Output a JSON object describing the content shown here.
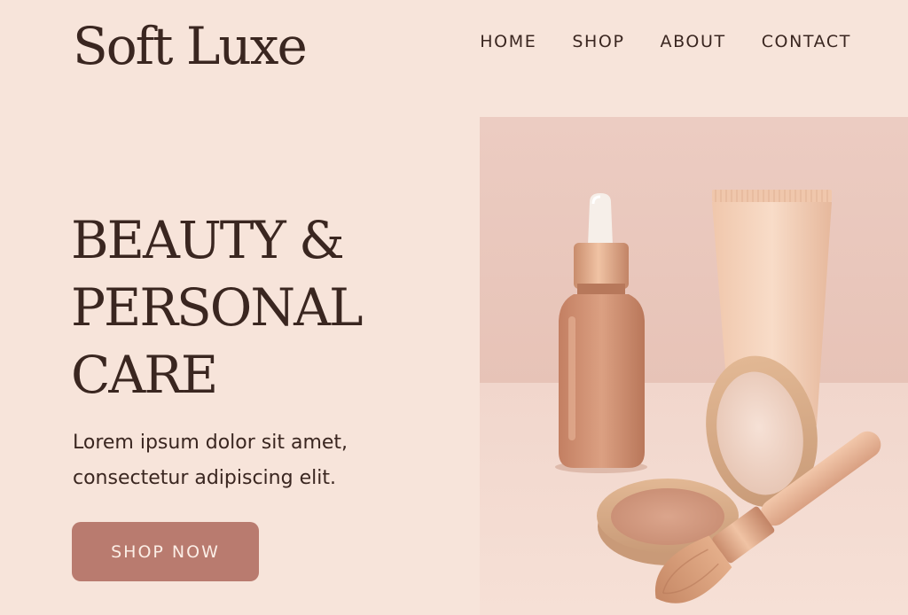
{
  "brand": {
    "name": "Soft Luxe"
  },
  "nav": {
    "items": [
      {
        "label": "HOME"
      },
      {
        "label": "SHOP"
      },
      {
        "label": "ABOUT"
      },
      {
        "label": "CONTACT"
      }
    ]
  },
  "hero": {
    "headline_lines": [
      "BEAUTY &",
      "PERSONAL",
      "CARE"
    ],
    "subtext_lines": [
      "Lorem ipsum dolor sit amet,",
      "consectetur adipiscing elit."
    ],
    "cta_label": "SHOP NOW"
  },
  "colors": {
    "background": "#f7e4da",
    "text": "#3a2620",
    "accent": "#b97b6f"
  },
  "icons": [
    "dropper-bottle",
    "cream-tube",
    "compact-powder",
    "makeup-brush"
  ]
}
